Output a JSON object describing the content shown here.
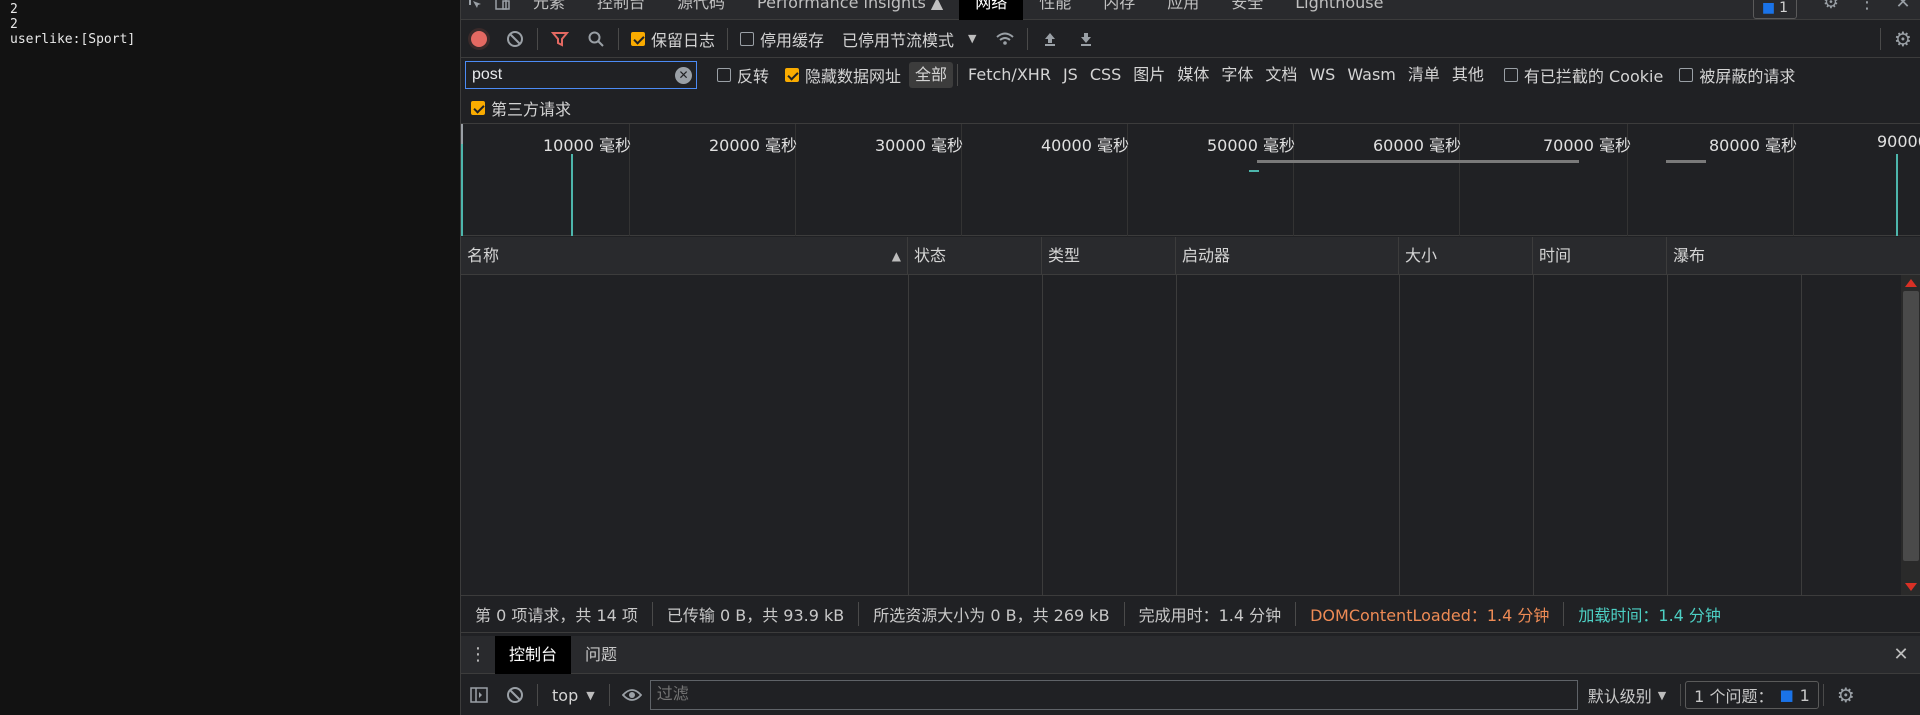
{
  "page": {
    "lines": [
      "2",
      "2",
      "userlike:[Sport]"
    ]
  },
  "devtools": {
    "main_tabs": [
      "元素",
      "控制台",
      "源代码",
      "Performance insights ▲",
      "网络",
      "性能",
      "内存",
      "应用",
      "安全",
      "Lighthouse"
    ],
    "active_tab": "网络",
    "issues_badge": "1",
    "toolbar": {
      "preserve_log": "保留日志",
      "disable_cache": "停用缓存",
      "throttling": "已停用节流模式"
    },
    "filter": {
      "value": "post",
      "invert": "反转",
      "hide_data_urls": "隐藏数据网址",
      "types": [
        "全部",
        "Fetch/XHR",
        "JS",
        "CSS",
        "图片",
        "媒体",
        "字体",
        "文档",
        "WS",
        "Wasm",
        "清单",
        "其他"
      ],
      "blocked_cookies": "有已拦截的 Cookie",
      "blocked_requests": "被屏蔽的请求",
      "third_party": "第三方请求"
    },
    "overview": {
      "ticks": [
        "10000 毫秒",
        "20000 毫秒",
        "30000 毫秒",
        "40000 毫秒",
        "50000 毫秒",
        "60000 毫秒",
        "70000 毫秒",
        "80000 毫秒",
        "90000"
      ]
    },
    "table": {
      "columns": [
        "名称",
        "状态",
        "类型",
        "启动器",
        "大小",
        "时间",
        "瀑布"
      ]
    },
    "status": {
      "requests": "第 0 项请求，共 14 项",
      "transferred": "已传输 0 B，共 93.9 kB",
      "resources": "所选资源大小为 0 B，共 269 kB",
      "finish": "完成用时：1.4 分钟",
      "dom_content_loaded": "DOMContentLoaded：1.4 分钟",
      "load": "加载时间：1.4 分钟"
    },
    "drawer": {
      "tabs": [
        "控制台",
        "问题"
      ],
      "context": "top",
      "filter_placeholder": "过滤",
      "level": "默认级别",
      "issues_label": "1 个问题：",
      "issues_count": "1"
    },
    "colors": {
      "record": "#e46962",
      "checkbox": "#f9ab00",
      "dcl": "#ee8b55",
      "load": "#4dd0c4",
      "accent": "#1a73e8"
    }
  }
}
